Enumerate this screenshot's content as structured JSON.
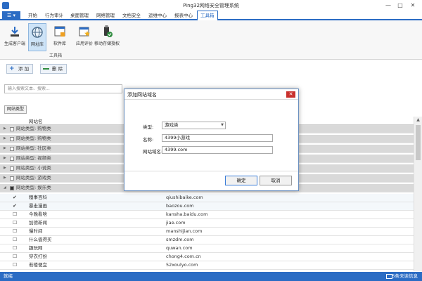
{
  "window": {
    "title": "Ping32网络安全管理系统"
  },
  "menu": {
    "app_button": "☰ ▾",
    "items": [
      {
        "label": "开始"
      },
      {
        "label": "行为审计"
      },
      {
        "label": "桌面管理"
      },
      {
        "label": "网络管理"
      },
      {
        "label": "文档安全"
      },
      {
        "label": "运维中心"
      },
      {
        "label": "报表中心"
      },
      {
        "label": "工具箱"
      }
    ]
  },
  "ribbon": {
    "buttons": [
      {
        "label": "生成客户端",
        "icon": "download-icon"
      },
      {
        "label": "网址库",
        "icon": "globe-icon"
      },
      {
        "label": "软件库",
        "icon": "software-library-icon"
      },
      {
        "label": "应用评价",
        "icon": "app-rating-icon"
      },
      {
        "label": "移动存储授权",
        "icon": "usb-auth-icon"
      }
    ],
    "group_label": "工具箱"
  },
  "toolbar": {
    "add_label": "添 加",
    "delete_label": "删 除"
  },
  "search": {
    "placeholder": "输入搜索文本、搜索..."
  },
  "grid": {
    "group_by": "网站类型",
    "column_name": "网站名",
    "groups": [
      {
        "label": "网站类型: 购物类"
      },
      {
        "label": "网站类型: 购物类"
      },
      {
        "label": "网站类型: 社区类"
      },
      {
        "label": "网站类型: 视频类"
      },
      {
        "label": "网站类型: 小说类"
      },
      {
        "label": "网站类型: 游戏类"
      },
      {
        "label": "网站类型: 娱乐类"
      }
    ],
    "rows": [
      {
        "name": "糗事百科",
        "domain": "qiushibaike.com",
        "checked": true
      },
      {
        "name": "暴走漫画",
        "domain": "baozou.com",
        "checked": true
      },
      {
        "name": "今晚看啥",
        "domain": "kansha.baidu.com",
        "checked": false
      },
      {
        "name": "加德新闻",
        "domain": "jiae.com",
        "checked": false
      },
      {
        "name": "慢时间",
        "domain": "manshijian.com",
        "checked": false
      },
      {
        "name": "什么值得买",
        "domain": "smzdm.com",
        "checked": false
      },
      {
        "name": "趣玩网",
        "domain": "quwan.com",
        "checked": false
      },
      {
        "name": "穿衣打扮",
        "domain": "chong4.com.cn",
        "checked": false
      },
      {
        "name": "若楼便宜",
        "domain": "52xoulyo.com",
        "checked": false
      }
    ]
  },
  "status": {
    "left": "就绪",
    "right": "5条未读信息"
  },
  "dialog": {
    "title": "添加网站域名",
    "type_label": "类型:",
    "type_value": "游戏类",
    "name_label": "名称:",
    "name_value": "4399小游戏",
    "domain_label": "网站域名:",
    "domain_value": "4399.com",
    "ok_label": "确定",
    "cancel_label": "取消"
  },
  "colors": {
    "accent": "#2b6cc4",
    "close": "#c9302c",
    "group_row": "#d9d9d9"
  }
}
